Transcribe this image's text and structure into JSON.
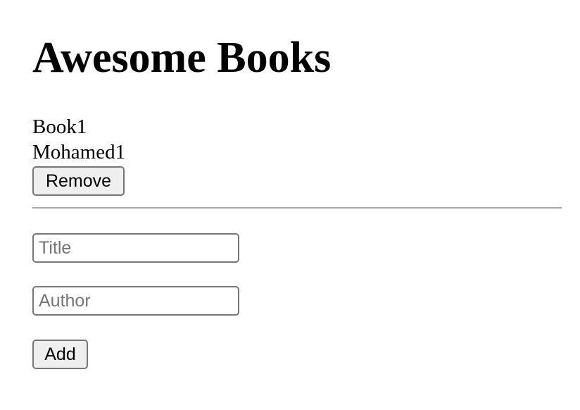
{
  "page": {
    "title": "Awesome Books"
  },
  "books": [
    {
      "title": "Book1",
      "author": "Mohamed1",
      "remove_label": "Remove"
    }
  ],
  "form": {
    "title_placeholder": "Title",
    "author_placeholder": "Author",
    "add_label": "Add"
  }
}
